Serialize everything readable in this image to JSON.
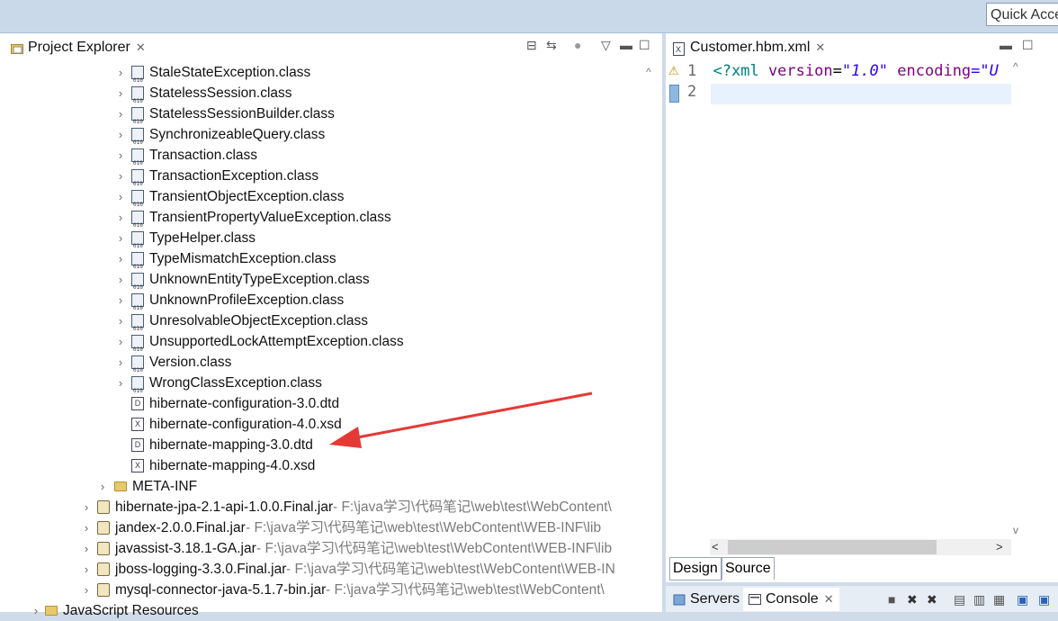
{
  "topbar": {
    "quick_access": "Quick Access"
  },
  "project_explorer": {
    "tab_label": "Project Explorer",
    "tree": [
      {
        "label": "StaleStateException.class",
        "type": "class"
      },
      {
        "label": "StatelessSession.class",
        "type": "class"
      },
      {
        "label": "StatelessSessionBuilder.class",
        "type": "class"
      },
      {
        "label": "SynchronizeableQuery.class",
        "type": "class"
      },
      {
        "label": "Transaction.class",
        "type": "class"
      },
      {
        "label": "TransactionException.class",
        "type": "class"
      },
      {
        "label": "TransientObjectException.class",
        "type": "class"
      },
      {
        "label": "TransientPropertyValueException.class",
        "type": "class"
      },
      {
        "label": "TypeHelper.class",
        "type": "class"
      },
      {
        "label": "TypeMismatchException.class",
        "type": "class"
      },
      {
        "label": "UnknownEntityTypeException.class",
        "type": "class"
      },
      {
        "label": "UnknownProfileException.class",
        "type": "class"
      },
      {
        "label": "UnresolvableObjectException.class",
        "type": "class"
      },
      {
        "label": "UnsupportedLockAttemptException.class",
        "type": "class"
      },
      {
        "label": "Version.class",
        "type": "class"
      },
      {
        "label": "WrongClassException.class",
        "type": "class"
      },
      {
        "label": "hibernate-configuration-3.0.dtd",
        "type": "dtd"
      },
      {
        "label": "hibernate-configuration-4.0.xsd",
        "type": "xsd"
      },
      {
        "label": "hibernate-mapping-3.0.dtd",
        "type": "dtd"
      },
      {
        "label": "hibernate-mapping-4.0.xsd",
        "type": "xsd"
      },
      {
        "label": "META-INF",
        "type": "folder"
      },
      {
        "label": "hibernate-jpa-2.1-api-1.0.0.Final.jar",
        "type": "jar",
        "path": " - F:\\java学习\\代码笔记\\web\\test\\WebContent\\"
      },
      {
        "label": "jandex-2.0.0.Final.jar",
        "type": "jar",
        "path": " - F:\\java学习\\代码笔记\\web\\test\\WebContent\\WEB-INF\\lib"
      },
      {
        "label": "javassist-3.18.1-GA.jar",
        "type": "jar",
        "path": " - F:\\java学习\\代码笔记\\web\\test\\WebContent\\WEB-INF\\lib"
      },
      {
        "label": "jboss-logging-3.3.0.Final.jar",
        "type": "jar",
        "path": " - F:\\java学习\\代码笔记\\web\\test\\WebContent\\WEB-IN"
      },
      {
        "label": "mysql-connector-java-5.1.7-bin.jar",
        "type": "jar",
        "path": " - F:\\java学习\\代码笔记\\web\\test\\WebContent\\"
      },
      {
        "label": "JavaScript Resources",
        "type": "folder"
      }
    ]
  },
  "editor": {
    "tab_label": "Customer.hbm.xml",
    "lines": [
      {
        "num": "1",
        "pi_open": "<?xml",
        "attr1": "version",
        "val1": "\"1.0\"",
        "attr2": "encoding",
        "val2": "=\"U"
      },
      {
        "num": "2"
      }
    ],
    "bottom_tabs": [
      "Design",
      "Source"
    ]
  },
  "console": {
    "tabs": [
      "Servers",
      "Console"
    ]
  },
  "colors": {
    "arrow": "#e53935",
    "accent": "#c9d9ea"
  }
}
